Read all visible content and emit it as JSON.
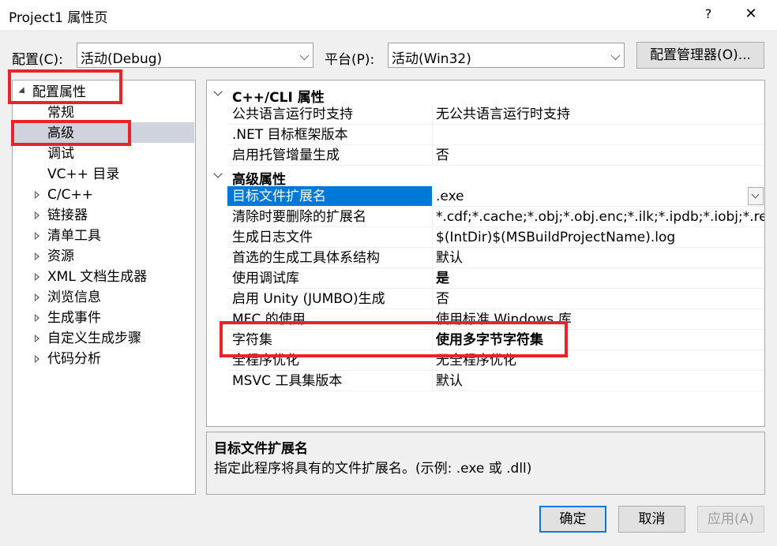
{
  "window": {
    "title": "Project1 属性页",
    "help_glyph": "?",
    "close_glyph": "✕"
  },
  "config_row": {
    "config_label": "配置(C):",
    "config_value": "活动(Debug)",
    "platform_label": "平台(P):",
    "platform_value": "活动(Win32)",
    "manager_button": "配置管理器(O)..."
  },
  "tree": {
    "root": {
      "label": "配置属性",
      "expanded": true
    },
    "items": [
      {
        "label": "常规",
        "expandable": false
      },
      {
        "label": "高级",
        "expandable": false,
        "selected": true
      },
      {
        "label": "调试",
        "expandable": false
      },
      {
        "label": "VC++ 目录",
        "expandable": false
      },
      {
        "label": "C/C++",
        "expandable": true
      },
      {
        "label": "链接器",
        "expandable": true
      },
      {
        "label": "清单工具",
        "expandable": true
      },
      {
        "label": "资源",
        "expandable": true
      },
      {
        "label": "XML 文档生成器",
        "expandable": true
      },
      {
        "label": "浏览信息",
        "expandable": true
      },
      {
        "label": "生成事件",
        "expandable": true
      },
      {
        "label": "自定义生成步骤",
        "expandable": true
      },
      {
        "label": "代码分析",
        "expandable": true
      }
    ]
  },
  "grid": {
    "categories": [
      {
        "label": "C++/CLI 属性",
        "properties": [
          {
            "name": "公共语言运行时支持",
            "value": "无公共语言运行时支持"
          },
          {
            "name": ".NET 目标框架版本",
            "value": ""
          },
          {
            "name": "启用托管增量生成",
            "value": "否"
          }
        ]
      },
      {
        "label": "高级属性",
        "properties": [
          {
            "name": "目标文件扩展名",
            "value": ".exe",
            "selected": true
          },
          {
            "name": "清除时要删除的扩展名",
            "value": "*.cdf;*.cache;*.obj;*.obj.enc;*.ilk;*.ipdb;*.iobj;*.resources;*.tlb;*.tli;*.tlh;*.tmp;*.rsp;*.pgc;*.pgd;*.meta;*.tlog;*.manifest;*.res;*.pch;*.exp;*.idb;*.rep;*.xdc;*.pdb;*_manifest.rc;*.bsc;*.sbr;*.xml;*.metagen;*.bi"
          },
          {
            "name": "生成日志文件",
            "value": "$(IntDir)$(MSBuildProjectName).log"
          },
          {
            "name": "首选的生成工具体系结构",
            "value": "默认"
          },
          {
            "name": "使用调试库",
            "value": "是",
            "bold": true
          },
          {
            "name": "启用 Unity (JUMBO)生成",
            "value": "否"
          },
          {
            "name": "MFC 的使用",
            "value": "使用标准 Windows 库"
          },
          {
            "name": "字符集",
            "value": "使用多字节字符集",
            "bold": true
          },
          {
            "name": "全程序优化",
            "value": "无全程序优化"
          },
          {
            "name": "MSVC 工具集版本",
            "value": "默认"
          }
        ]
      }
    ]
  },
  "description": {
    "title": "目标文件扩展名",
    "text": "指定此程序将具有的文件扩展名。(示例: .exe 或 .dll)"
  },
  "buttons": {
    "ok": "确定",
    "cancel": "取消",
    "apply": "应用(A)"
  },
  "colors": {
    "selection": "#0078d7",
    "highlight_box": "#e8242b",
    "tree_selection": "#cfd3dd"
  }
}
